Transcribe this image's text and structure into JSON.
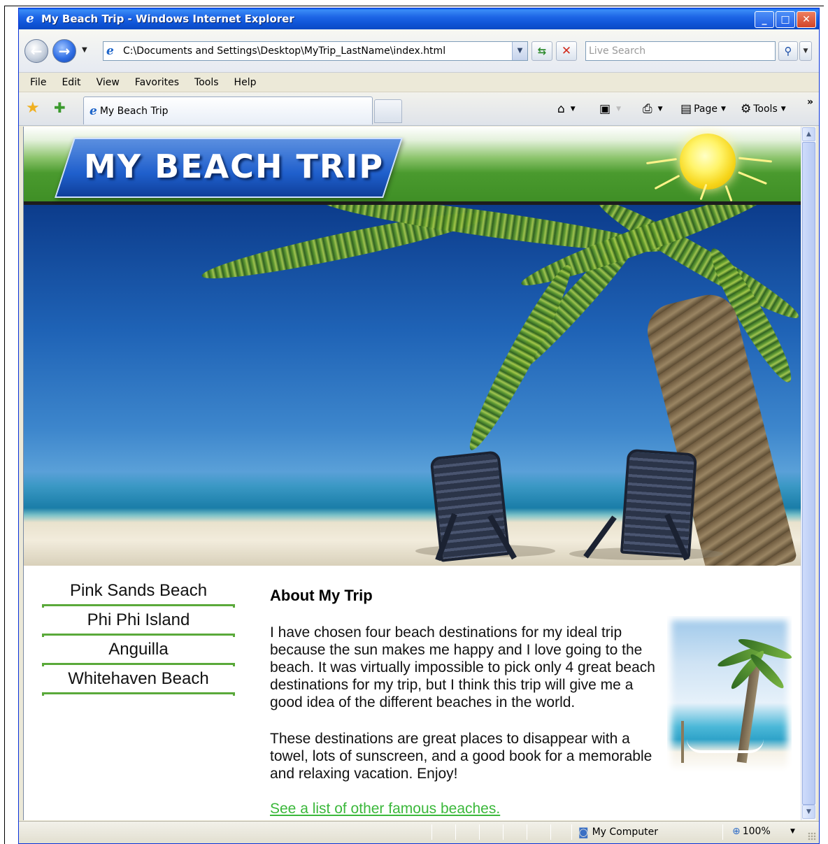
{
  "window": {
    "title": "My Beach Trip - Windows Internet Explorer",
    "controls": [
      "minimize",
      "maximize",
      "close"
    ]
  },
  "address_bar": {
    "url": "C:\\Documents and Settings\\Desktop\\MyTrip_LastName\\index.html",
    "search_placeholder": "Live Search"
  },
  "menu": {
    "items": [
      "File",
      "Edit",
      "View",
      "Favorites",
      "Tools",
      "Help"
    ]
  },
  "tabs": {
    "active_tab_label": "My Beach Trip"
  },
  "command_bar": {
    "page_label": "Page",
    "tools_label": "Tools",
    "overflow": "»"
  },
  "page": {
    "banner_title": "MY BEACH TRIP",
    "nav_links": [
      "Pink Sands Beach",
      "Phi Phi Island",
      "Anguilla",
      "Whitehaven Beach"
    ],
    "about_heading": "About My Trip",
    "paragraph1": "I have chosen four beach destinations for my ideal trip because the sun makes me happy and I love going to the beach. It was virtually impossible to pick only 4 great beach destinations for my trip, but I think this trip will give me a good idea of the different beaches in the world.",
    "paragraph2": "These destinations are great places to disappear with a towel, lots of sunscreen, and a good book for a memorable and relaxing vacation. Enjoy!",
    "more_link": "See a list of other famous beaches."
  },
  "status_bar": {
    "zone": "My Computer",
    "zoom": "100%"
  },
  "colors": {
    "titlebar": "#0a55d8",
    "banner_green": "#4a9a2e",
    "link_green": "#3bb83b",
    "nav_underline": "#5aa93a"
  },
  "icons": [
    "ie-logo-icon",
    "back-arrow-icon",
    "forward-arrow-icon",
    "refresh-icon",
    "stop-icon",
    "search-icon",
    "favorites-star-icon",
    "add-favorites-icon",
    "home-icon",
    "feeds-icon",
    "print-icon",
    "page-icon",
    "tools-gear-icon",
    "computer-zone-icon",
    "zoom-icon"
  ]
}
